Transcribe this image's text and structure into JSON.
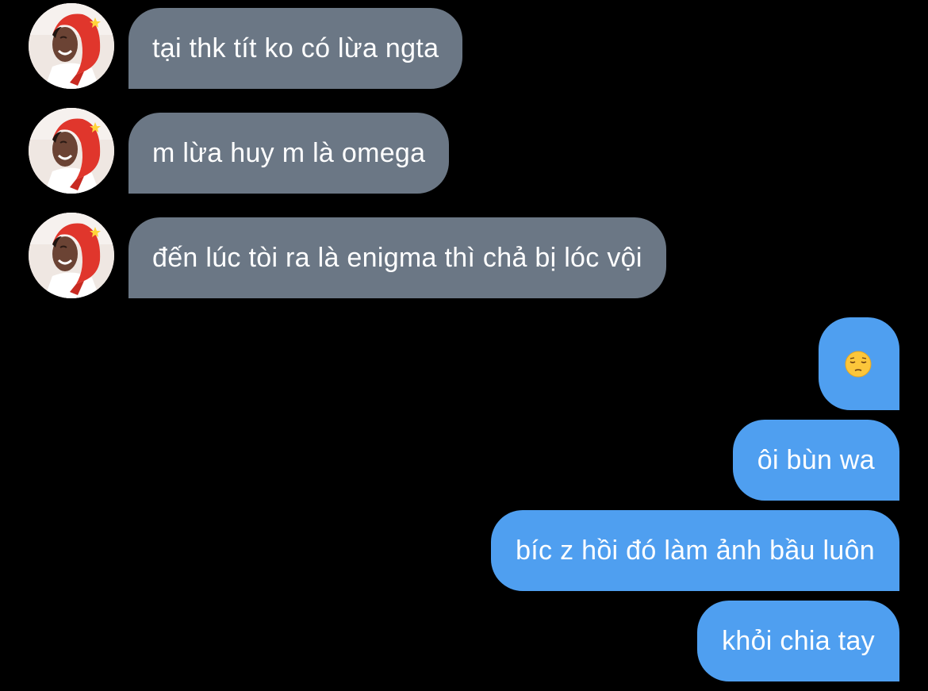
{
  "conversation": {
    "incoming": [
      {
        "text": "tại thk tít ko có lừa ngta"
      },
      {
        "text": "m lừa huy m là omega"
      },
      {
        "text": "đến lúc tòi ra là enigma thì chả bị lóc vội"
      }
    ],
    "outgoing": [
      {
        "emoji": "pensive-face-icon"
      },
      {
        "text": "ôi bùn wa"
      },
      {
        "text": "bíc z hồi đó làm ảnh bầu luôn"
      },
      {
        "text": "khỏi chia tay"
      }
    ]
  },
  "colors": {
    "background": "#000000",
    "incoming_bubble": "#6b7785",
    "outgoing_bubble": "#4f9ff0",
    "text": "#ffffff"
  }
}
